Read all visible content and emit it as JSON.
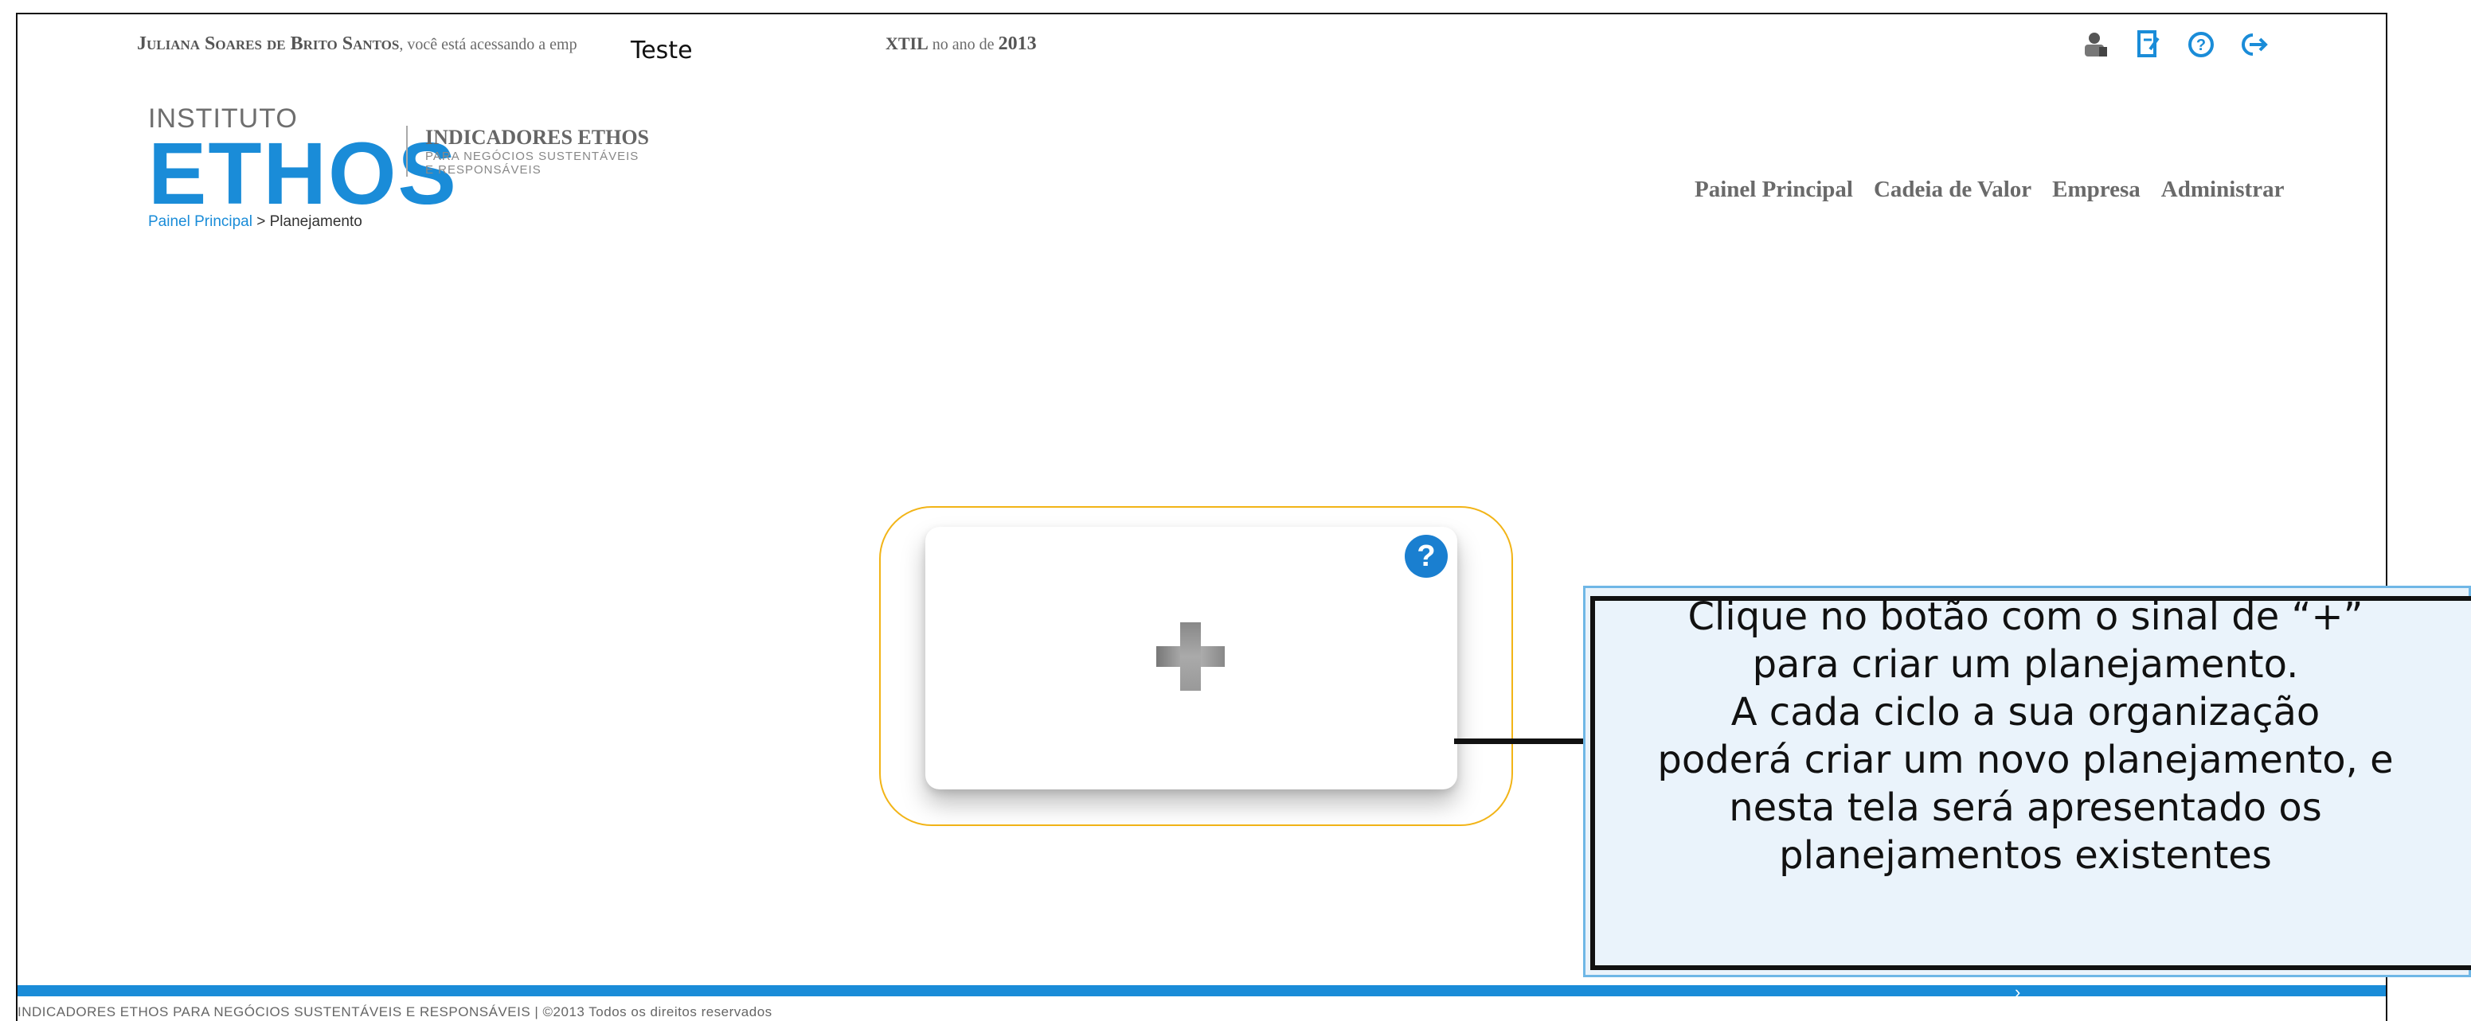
{
  "header": {
    "user_name": "Juliana Soares de Brito Santos",
    "access_text": ", você está acessando a emp",
    "company_fragment": "XTIL",
    "year_text": " no ano de ",
    "year": "2013",
    "overlay_label": "Teste",
    "icons": [
      "user-icon",
      "report-icon",
      "help-icon",
      "logout-icon"
    ]
  },
  "logo": {
    "instituto": "INSTITUTO",
    "ethos": "ETHOS",
    "title": "INDICADORES ETHOS",
    "subtitle_line1": "PARA NEGÓCIOS SUSTENTÁVEIS",
    "subtitle_line2": "E RESPONSÁVEIS"
  },
  "breadcrumb": {
    "root": "Painel Principal",
    "separator": " > ",
    "current": "Planejamento"
  },
  "nav": [
    {
      "label": "Painel Principal"
    },
    {
      "label": "Cadeia de Valor"
    },
    {
      "label": "Empresa"
    },
    {
      "label": "Administrar"
    }
  ],
  "card": {
    "help_glyph": "?",
    "add_action": "add-planning"
  },
  "callout": {
    "lines": [
      "Clique no botão com o sinal de “+”",
      "para criar um planejamento.",
      "A cada ciclo a sua organização",
      "poderá criar um novo planejamento, e",
      "nesta tela será apresentado os",
      "planejamentos existentes"
    ]
  },
  "footer": {
    "text": "INDICADORES ETHOS PARA NEGÓCIOS SUSTENTÁVEIS E RESPONSÁVEIS | ©2013 Todos os direitos reservados"
  },
  "colors": {
    "brand_blue": "#1a8cd8",
    "highlight": "#f2b417",
    "callout_bg": "#eaf3fb"
  }
}
